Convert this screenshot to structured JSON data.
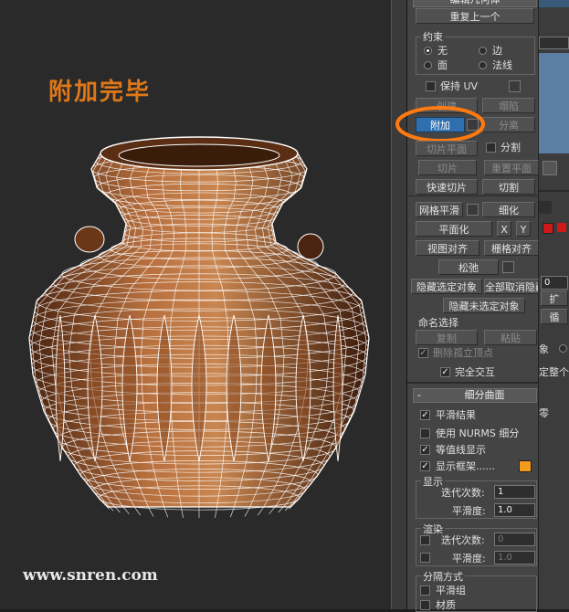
{
  "viewport": {
    "title": "附加完毕",
    "watermark": "www.snren.com"
  },
  "panel": {
    "top_cut": "编辑几何体",
    "repeat_last": "重复上一个",
    "constraints": {
      "group": "约束",
      "none": "无",
      "edge": "边",
      "face": "面",
      "normal": "法线"
    },
    "preserve_uv": "保持 UV",
    "create": "创建",
    "collapse": "塌陷",
    "attach": "附加",
    "detach": "分离",
    "slice_plane": "切片平面",
    "split": "分割",
    "slice": "切片",
    "reset_plane": "重置平面",
    "quickslice": "快速切片",
    "cut": "切割",
    "meshsmooth": "网格平滑",
    "tessellate": "细化",
    "make_planar": "平面化",
    "x": "X",
    "y": "Y",
    "view_align": "视图对齐",
    "grid_align": "栅格对齐",
    "relax": "松弛",
    "hide_selected": "隐藏选定对象",
    "unhide_all": "全部取消隐藏",
    "hide_unselected": "隐藏未选定对象",
    "named_selections": "命名选择",
    "copy": "复制",
    "paste": "粘贴",
    "delete_isolated": "删除孤立顶点",
    "full_interactivity": "完全交互",
    "subdiv_header": "细分曲面",
    "smooth_result": "平滑结果",
    "use_nurms": "使用 NURMS 细分",
    "isoline_display": "等值线显示",
    "show_cage": "显示框架......",
    "display_group": "显示",
    "iterations_label": "迭代次数:",
    "iterations_value": "1",
    "smoothness_label": "平滑度:",
    "smoothness_value": "1.0",
    "render_group": "渲染",
    "render_iterations_value": "0",
    "render_smoothness_value": "1.0",
    "separate_by": "分隔方式",
    "smoothing_groups": "平滑组",
    "materials": "材质",
    "cage_color": "#f29a1c"
  },
  "side": {
    "t1": "扩",
    "t2": "循",
    "t3": "象",
    "t4": "定整个",
    "t5": "零",
    "t6": "0"
  },
  "colors": {
    "title": "#e07818",
    "highlight": "#ff7a10"
  }
}
